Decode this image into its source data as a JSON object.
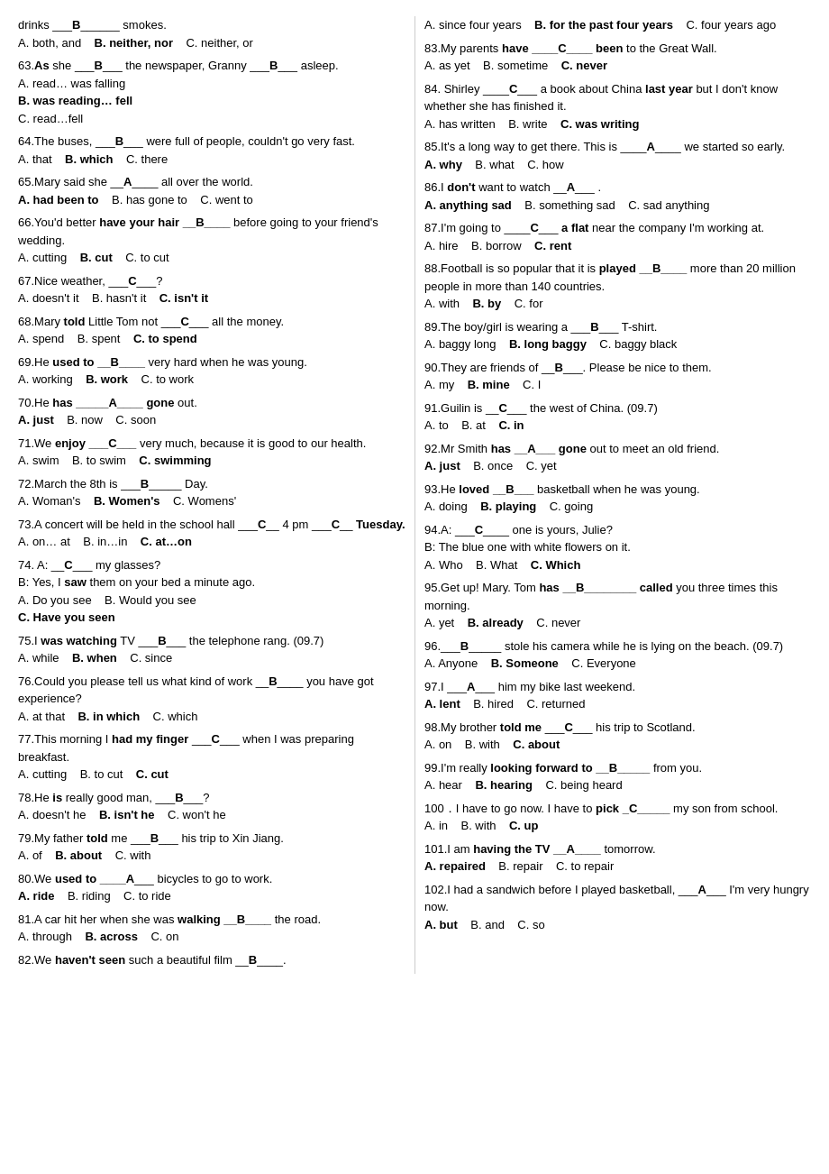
{
  "left_column": [
    {
      "id": "intro",
      "text": "drinks __B______ smokes.",
      "options": "A. both, and    <b>B. neither, nor</b>    C. neither, or"
    },
    {
      "id": "q63",
      "text": "63.<b>As</b> she ___<b>B</b>___ the newspaper, Granny ___<b>B</b>___ asleep.",
      "options1": "A. read… was falling",
      "options2": "<b>B. was reading… fell</b>",
      "options3": "C. read…fell"
    },
    {
      "id": "q64",
      "text": "64.The buses, ___<b>B</b>___ were full of people, couldn't go very fast.",
      "options": "A.  that    <b>B.  which</b>    C.   there"
    },
    {
      "id": "q65",
      "text": "65.Mary said she __<b>A</b>____ all over the world.",
      "options": "A. <b>had been to</b>    B.  has gone to   C.   went to"
    },
    {
      "id": "q66",
      "text": "66.You'd better <b>have your hair __B____</b> before going to your friend's wedding.",
      "options": "A.   cutting    <b>B.   cut</b>    C.  to cut"
    },
    {
      "id": "q67",
      "text": "67.Nice weather, ___<b>C</b>___?",
      "options": "A.   doesn't it    B.   hasn't it    <b>C.   isn't it</b>"
    },
    {
      "id": "q68",
      "text": "68.Mary <b>told</b> Little Tom not ___<b>C</b>___ all the money.",
      "options": "A.   spend    B.   spent    <b>C.  to spend</b>"
    },
    {
      "id": "q69",
      "text": "69.He <b>used to __B____</b> very hard when he was young.",
      "options": "A.   working    <b>B.  work</b>    C.  to work"
    },
    {
      "id": "q70",
      "text": "70.He <b>has _____A____ gone</b> out.",
      "options": "<b>A. just</b>    B.  now    C.  soon"
    },
    {
      "id": "q71",
      "text": "71.We <b>enjoy ___C___</b> very much, because it is good to our health.",
      "options": "A.   swim    B.   to swim    <b>C.  swimming</b>"
    },
    {
      "id": "q72",
      "text": "72.March the 8th is ___<b>B</b>_____ Day.",
      "options": "A.  Woman's    <b>B.  Women's</b>    C.  Womens'"
    },
    {
      "id": "q73",
      "text": "73.A concert will be held in the school hall ___<b>C</b>__ 4 pm ___<b>C</b>__ <b>Tuesday.</b>",
      "options": "A.   on… at    B.  in…in    <b>C.  at…on</b>"
    },
    {
      "id": "q74",
      "text": "74. A:   __<b>C</b>___ my glasses?",
      "sub": "B:  Yes, I <b>saw</b> them on your bed a minute ago.",
      "options1": "A.   Do you see    B.    Would you see",
      "options2": "<b>C.   Have you seen</b>"
    },
    {
      "id": "q75",
      "text": "75.I <b>was watching</b> TV ___<b>B</b>___ the telephone rang. (09.7)",
      "options": "A.  while    <b>B.  when</b>    C.  since"
    },
    {
      "id": "q76",
      "text": "76.Could you please tell us what kind of work __<b>B</b>____ you have got experience?",
      "options": "A.   at that    <b>B.   in which</b>    C.   which"
    },
    {
      "id": "q77",
      "text": "77.This morning I <b>had my finger</b> ___<b>C</b>___ when I was preparing breakfast.",
      "options": "A.   cutting    B.   to cut   <b>C.   cut</b>"
    },
    {
      "id": "q78",
      "text": "78.He <b>is</b> really good man, ___<b>B</b>___?",
      "options": "A.   doesn't he    <b>B.   isn't he</b>    C.  won't he"
    },
    {
      "id": "q79",
      "text": "79.My father <b>told</b> me ___<b>B</b>___ his trip to Xin Jiang.",
      "options": "A.   of    <b>B.   about</b>    C.   with"
    },
    {
      "id": "q80",
      "text": "80.We <b>used to ____A</b>___ bicycles to go to work.",
      "options": "<b>A.  ride</b>    B.   riding    C.   to ride"
    },
    {
      "id": "q81",
      "text": "81.A car hit her when she was <b>walking __B____</b> the road.",
      "options": "A.   through    <b>B.   across</b>    C.   on"
    },
    {
      "id": "q82",
      "text": "82.We <b>haven't seen</b> such a beautiful film __<b>B</b>____."
    }
  ],
  "right_column": [
    {
      "id": "q82_opts",
      "text": "A. since four years    <b>B. for the past four years</b>    C.   four years ago"
    },
    {
      "id": "q83",
      "text": "83.My parents <b>have ____C____ been</b> to the Great Wall.",
      "options": "A.  as yet    B.  sometime    <b>C.  never</b>"
    },
    {
      "id": "q84",
      "text": "84. Shirley ____<b>C</b>___ a book about China <b>last year</b> but I don't know whether she has finished it.",
      "options": "A.   has written    B.   write    <b>C.   was writing</b>"
    },
    {
      "id": "q85",
      "text": "85.It's a long way to get there. This is ____<b>A</b>____ we started so early.",
      "options": "<b>A. why</b>    B.  what    C.  how"
    },
    {
      "id": "q86",
      "text": "86.I <b>don't</b> want to watch __<b>A</b>___ .",
      "options": "<b>A. anything sad</b>    B.  something sad    C.  sad anything"
    },
    {
      "id": "q87",
      "text": "87.I'm going to ____<b>C</b>___ <b>a flat</b> near the company I'm working at.",
      "options": "A.   hire    B.   borrow    <b>C.  rent</b>"
    },
    {
      "id": "q88",
      "text": "88.Football is so popular that it is <b>played __B____</b> more than 20 million people in more than 140 countries.",
      "options": "A.   with    <b>B.   by</b>    C.   for"
    },
    {
      "id": "q89",
      "text": "89.The boy/girl is wearing a ___<b>B</b>___ T-shirt.",
      "options": "A.   baggy long   <b>B.  long baggy</b>    C.   baggy black"
    },
    {
      "id": "q90",
      "text": "90.They are friends of __<b>B</b>___. Please be nice to them.",
      "options": "A.   my    <b>B.   mine</b>    C.   I"
    },
    {
      "id": "q91",
      "text": "91.Guilin is __<b>C</b>___ the west of China. (09.7)",
      "options": "A.   to    B.   at    <b>C.  in</b>"
    },
    {
      "id": "q92",
      "text": "92.Mr Smith <b>has __A___ gone</b> out to meet an old friend.",
      "options": "<b>A.   just</b>    B.   once    C.   yet"
    },
    {
      "id": "q93",
      "text": "93.He <b>loved __B___</b> basketball when he was young.",
      "options": "A.  doing    <b>B.  playing</b>    C.  going"
    },
    {
      "id": "q94",
      "text": "94.A:  ___<b>C</b>____ one is yours, Julie?",
      "sub": "B: The blue one with white flowers on it.",
      "options": "A.  Who    B.  What    <b>C.  Which</b>"
    },
    {
      "id": "q95",
      "text": "95.Get up! Mary. Tom <b>has __B________ called</b> you three times this morning.",
      "options": "A.  yet    <b>B.  already</b>    C.  never"
    },
    {
      "id": "q96",
      "text": "96.___<b>B</b>_____ stole his camera while he is lying on the beach. (09.7)",
      "options": "A.   Anyone    <b>B.   Someone</b>    C.  Everyone"
    },
    {
      "id": "q97",
      "text": "97.I ___<b>A</b>___ him my bike last weekend.",
      "options": "<b>A.   lent</b>    B.   hired  C.   returned"
    },
    {
      "id": "q98",
      "text": "98.My brother <b>told me</b> ___<b>C</b>___ his trip to Scotland.",
      "options": "A.   on    B.   with    <b>C.   about</b>"
    },
    {
      "id": "q99",
      "text": "99.I'm really <b>looking forward to __B_____</b> from you.",
      "options": "A.   hear    <b>B.   hearing</b>    C.   being heard"
    },
    {
      "id": "q100",
      "text": "100．I have to go now. I have to <b>pick _C_____</b> my son from school.",
      "options": "A.   in    B.   with    <b>C.   up</b>"
    },
    {
      "id": "q101",
      "text": "101.I am <b>having the TV __A____</b> tomorrow.",
      "options": "<b>A.   repaired</b>    B.  repair    C.   to repair"
    },
    {
      "id": "q102",
      "text": "102.I had a sandwich before I played basketball, ___<b>A</b>___ I'm very hungry now.",
      "options": "<b>A.   but</b>    B.  and    C.  so"
    }
  ]
}
